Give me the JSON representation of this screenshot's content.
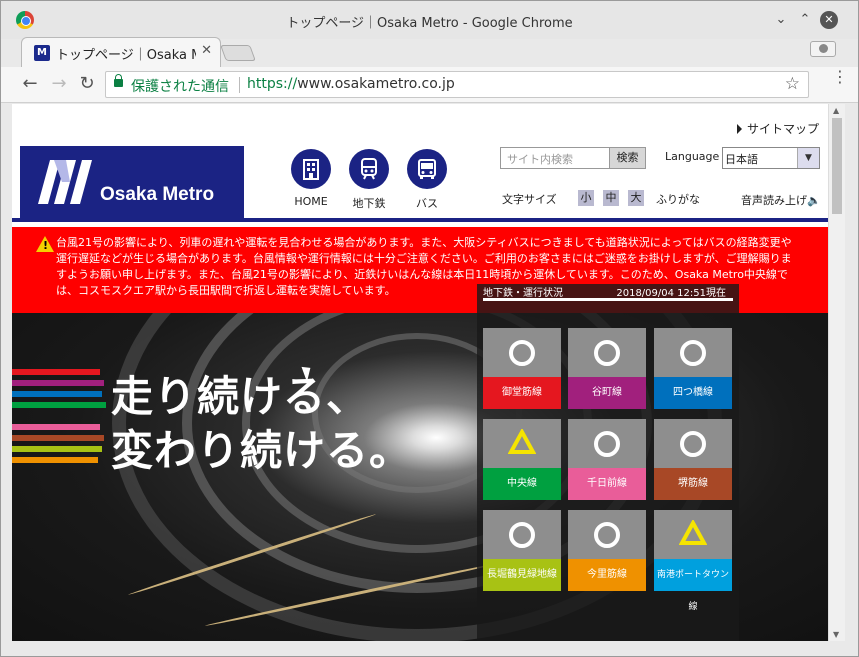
{
  "window": {
    "title": "トップページ｜Osaka Metro - Google Chrome"
  },
  "tab": {
    "label": "トップページ｜Osaka Metro",
    "favicon": "M"
  },
  "address_bar": {
    "secure_label": "保護された通信",
    "url_scheme": "https://",
    "url_host": "www.osakametro.co.jp"
  },
  "header": {
    "sitemap": "サイトマップ",
    "logo_text": "Osaka Metro",
    "nav": [
      {
        "label": "HOME",
        "icon": "building-icon"
      },
      {
        "label": "地下鉄",
        "icon": "train-icon"
      },
      {
        "label": "バス",
        "icon": "bus-icon"
      }
    ],
    "search_placeholder": "サイト内検索",
    "search_button": "検索",
    "language_label": "Language",
    "language_value": "日本語",
    "fontsize_label": "文字サイズ",
    "fontsize_small": "小",
    "fontsize_medium": "中",
    "fontsize_large": "大",
    "furigana": "ふりがな",
    "tts": "音声読み上げ",
    "brand_color": "#1b2384"
  },
  "alert": {
    "text": "台風21号の影響により、列車の遅れや運転を見合わせる場合があります。また、大阪シティバスにつきましても道路状況によってはバスの経路変更や運行遅延などが生じる場合があります。台風情報や運行情報には十分ご注意ください。ご利用のお客さまにはご迷惑をお掛けしますが、ご理解賜りますようお願い申し上げます。また、台風21号の影響により、近鉄けいはんな線は本日11時頃から運休しています。このため、Osaka Metro中央線では、コスモスクエア駅から長田駅間で折返し運転を実施しています。",
    "color": "#ff0000"
  },
  "hero": {
    "slogan_line1": "走り続ける、",
    "slogan_line2": "変わり続ける。"
  },
  "status": {
    "title": "地下鉄・運行状況",
    "timestamp": "2018/09/04 12:51現在",
    "lines": [
      {
        "name": "御堂筋線",
        "status": "circle",
        "color": "#e5171f"
      },
      {
        "name": "谷町線",
        "status": "circle",
        "color": "#a1207d"
      },
      {
        "name": "四つ橋線",
        "status": "circle",
        "color": "#0070bd"
      },
      {
        "name": "中央線",
        "status": "triangle",
        "color": "#00a040"
      },
      {
        "name": "千日前線",
        "status": "circle",
        "color": "#e95d99"
      },
      {
        "name": "堺筋線",
        "status": "circle",
        "color": "#a84826"
      },
      {
        "name": "長堀鶴見緑地線",
        "status": "circle",
        "color": "#a8c214"
      },
      {
        "name": "今里筋線",
        "status": "circle",
        "color": "#ef9100"
      },
      {
        "name": "南港ポートタウン線",
        "status": "triangle",
        "color": "#00a0de"
      }
    ]
  }
}
